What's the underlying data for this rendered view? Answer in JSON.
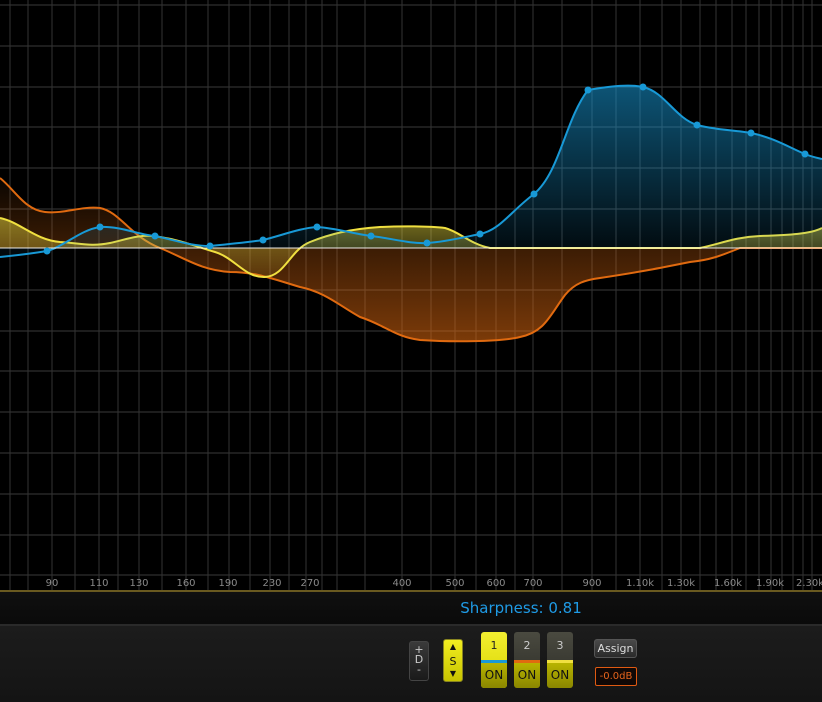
{
  "freq_axis": {
    "labels": [
      "90",
      "110",
      "130",
      "160",
      "190",
      "230",
      "270",
      "400",
      "500",
      "600",
      "700",
      "900",
      "1.10k",
      "1.30k",
      "1.60k",
      "1.90k",
      "2.30k"
    ]
  },
  "curves": [
    {
      "name": "band-1",
      "color": "#f0e040"
    },
    {
      "name": "band-2",
      "color": "#e06a10"
    },
    {
      "name": "band-3",
      "color": "#1899d6"
    }
  ],
  "status": {
    "sharpness": "Sharpness: 0.81"
  },
  "controls": {
    "d_toggle": {
      "plus": "+",
      "letter": "D",
      "minus": "-"
    },
    "s_toggle": {
      "up": "▲",
      "letter": "S",
      "down": "▼"
    },
    "bands": [
      {
        "num": "1",
        "state": "ON",
        "color": "#1899d6",
        "active": true
      },
      {
        "num": "2",
        "state": "ON",
        "color": "#e06a10",
        "active": false
      },
      {
        "num": "3",
        "state": "ON",
        "color": "#f0e040",
        "active": false
      }
    ],
    "assign_label": "Assign",
    "gain": "-0.0dB"
  }
}
